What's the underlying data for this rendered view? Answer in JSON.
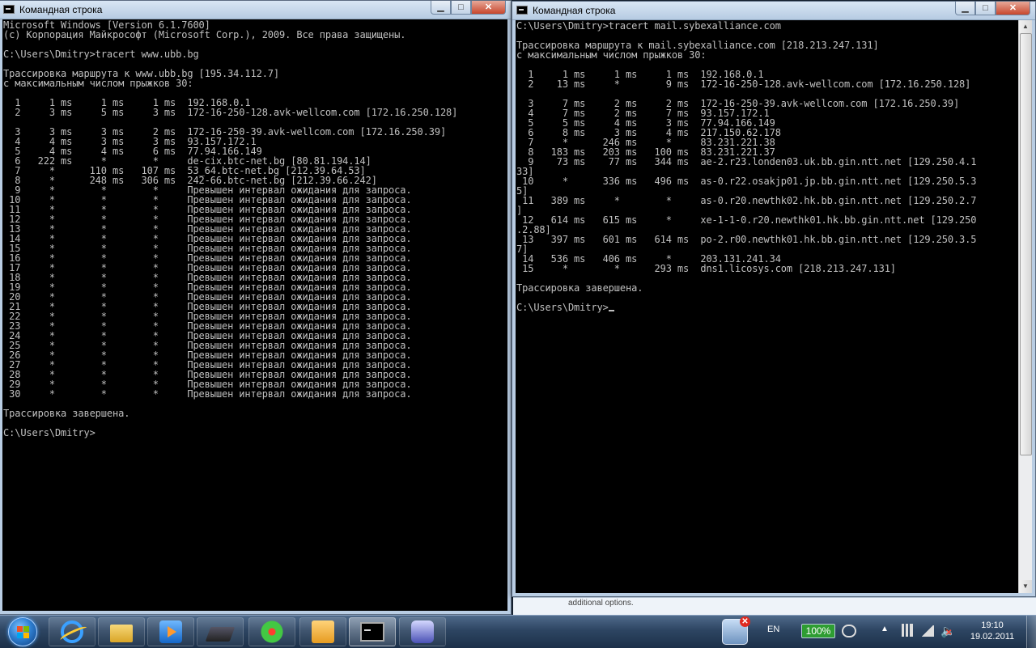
{
  "windows": {
    "left": {
      "title": "Командная строка",
      "lines": [
        "Microsoft Windows [Version 6.1.7600]",
        "(с) Корпорация Майкрософт (Microsoft Corp.), 2009. Все права защищены.",
        "",
        "C:\\Users\\Dmitry>tracert www.ubb.bg",
        "",
        "Трассировка маршрута к www.ubb.bg [195.34.112.7]",
        "с максимальным числом прыжков 30:",
        "",
        "  1     1 ms     1 ms     1 ms  192.168.0.1",
        "  2     3 ms     5 ms     3 ms  172-16-250-128.avk-wellcom.com [172.16.250.128]",
        "",
        "  3     3 ms     3 ms     2 ms  172-16-250-39.avk-wellcom.com [172.16.250.39]",
        "  4     4 ms     3 ms     3 ms  93.157.172.1",
        "  5     4 ms     4 ms     6 ms  77.94.166.149",
        "  6   222 ms     *        *     de-cix.btc-net.bg [80.81.194.14]",
        "  7     *      110 ms   107 ms  53_64.btc-net.bg [212.39.64.53]",
        "  8     *      248 ms   306 ms  242-66.btc-net.bg [212.39.66.242]",
        "  9     *        *        *     Превышен интервал ожидания для запроса.",
        " 10     *        *        *     Превышен интервал ожидания для запроса.",
        " 11     *        *        *     Превышен интервал ожидания для запроса.",
        " 12     *        *        *     Превышен интервал ожидания для запроса.",
        " 13     *        *        *     Превышен интервал ожидания для запроса.",
        " 14     *        *        *     Превышен интервал ожидания для запроса.",
        " 15     *        *        *     Превышен интервал ожидания для запроса.",
        " 16     *        *        *     Превышен интервал ожидания для запроса.",
        " 17     *        *        *     Превышен интервал ожидания для запроса.",
        " 18     *        *        *     Превышен интервал ожидания для запроса.",
        " 19     *        *        *     Превышен интервал ожидания для запроса.",
        " 20     *        *        *     Превышен интервал ожидания для запроса.",
        " 21     *        *        *     Превышен интервал ожидания для запроса.",
        " 22     *        *        *     Превышен интервал ожидания для запроса.",
        " 23     *        *        *     Превышен интервал ожидания для запроса.",
        " 24     *        *        *     Превышен интервал ожидания для запроса.",
        " 25     *        *        *     Превышен интервал ожидания для запроса.",
        " 26     *        *        *     Превышен интервал ожидания для запроса.",
        " 27     *        *        *     Превышен интервал ожидания для запроса.",
        " 28     *        *        *     Превышен интервал ожидания для запроса.",
        " 29     *        *        *     Превышен интервал ожидания для запроса.",
        " 30     *        *        *     Превышен интервал ожидания для запроса.",
        "",
        "Трассировка завершена.",
        "",
        "C:\\Users\\Dmitry>"
      ]
    },
    "right": {
      "title": "Командная строка",
      "prompt": "C:\\Users\\Dmitry>",
      "lines": [
        "C:\\Users\\Dmitry>tracert mail.sybexalliance.com",
        "",
        "Трассировка маршрута к mail.sybexalliance.com [218.213.247.131]",
        "с максимальным числом прыжков 30:",
        "",
        "  1     1 ms     1 ms     1 ms  192.168.0.1",
        "  2    13 ms     *        9 ms  172-16-250-128.avk-wellcom.com [172.16.250.128]",
        "",
        "  3     7 ms     2 ms     2 ms  172-16-250-39.avk-wellcom.com [172.16.250.39]",
        "  4     7 ms     2 ms     7 ms  93.157.172.1",
        "  5     5 ms     4 ms     3 ms  77.94.166.149",
        "  6     8 ms     3 ms     4 ms  217.150.62.178",
        "  7     *      246 ms     *     83.231.221.38",
        "  8   183 ms   203 ms   100 ms  83.231.221.37",
        "  9    73 ms    77 ms   344 ms  ae-2.r23.londen03.uk.bb.gin.ntt.net [129.250.4.1",
        "33]",
        " 10     *      336 ms   496 ms  as-0.r22.osakjp01.jp.bb.gin.ntt.net [129.250.5.3",
        "5]",
        " 11   389 ms     *        *     as-0.r20.newthk02.hk.bb.gin.ntt.net [129.250.2.7",
        "]",
        " 12   614 ms   615 ms     *     xe-1-1-0.r20.newthk01.hk.bb.gin.ntt.net [129.250",
        ".2.88]",
        " 13   397 ms   601 ms   614 ms  po-2.r00.newthk01.hk.bb.gin.ntt.net [129.250.3.5",
        "7]",
        " 14   536 ms   406 ms     *     203.131.241.34",
        " 15     *        *      293 ms  dns1.licosys.com [218.213.247.131]",
        "",
        "Трассировка завершена.",
        ""
      ]
    }
  },
  "background_window_text": "additional options.",
  "tray": {
    "language": "EN",
    "battery": "100%",
    "time": "19:10",
    "date": "19.02.2011"
  },
  "colors": {
    "console_bg": "#000000",
    "console_text": "#c0c0c0",
    "taskbar": "#2d4562",
    "titlebar": "#b6cbe2",
    "close_button": "#c7472d"
  }
}
